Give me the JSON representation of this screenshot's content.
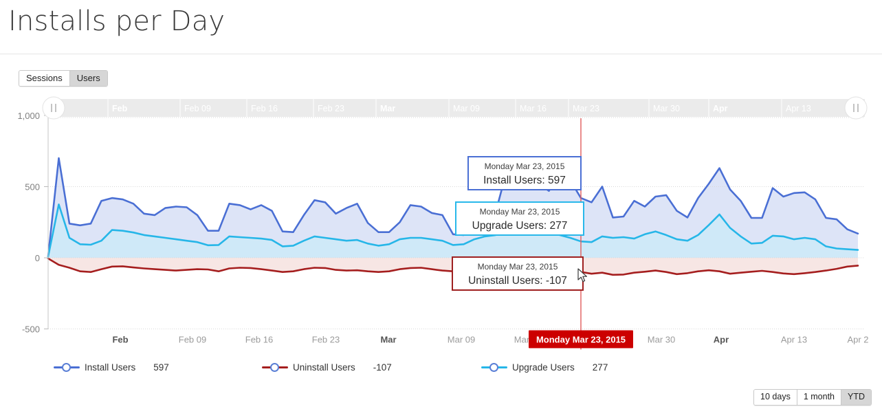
{
  "header": {
    "title": "Installs per Day"
  },
  "mode_toggle": {
    "options": [
      {
        "label": "Sessions",
        "active": false
      },
      {
        "label": "Users",
        "active": true
      }
    ]
  },
  "range_selector": {
    "options": [
      {
        "label": "10 days",
        "active": false
      },
      {
        "label": "1 month",
        "active": false
      },
      {
        "label": "YTD",
        "active": true
      }
    ]
  },
  "navigator": {
    "labels": [
      "Feb",
      "Feb 09",
      "Feb 16",
      "Feb 23",
      "Mar",
      "Mar 09",
      "Mar 16",
      "Mar 23",
      "Mar 30",
      "Apr",
      "Apr 13"
    ],
    "bold": [
      true,
      false,
      false,
      false,
      true,
      false,
      false,
      false,
      false,
      true,
      false
    ],
    "left_handle_icon": "drag-handle-icon",
    "right_handle_icon": "drag-handle-icon"
  },
  "tooltips": [
    {
      "date": "Monday Mar 23, 2015",
      "value": "Install Users: 597",
      "color": "#4a6fd4",
      "name": "install-users"
    },
    {
      "date": "Monday Mar 23, 2015",
      "value": "Upgrade Users: 277",
      "color": "#28b8ea",
      "name": "upgrade-users"
    },
    {
      "date": "Monday Mar 23, 2015",
      "value": "Uninstall Users: -107",
      "color": "#9e2020",
      "name": "uninstall-users"
    }
  ],
  "crosshair": {
    "label": "Monday Mar 23, 2015",
    "color": "#cc0000"
  },
  "legend": [
    {
      "name": "Install Users",
      "value": "597",
      "color": "#4a6fd4"
    },
    {
      "name": "Uninstall Users",
      "value": "-107",
      "color": "#a51e1e"
    },
    {
      "name": "Upgrade Users",
      "value": "277",
      "color": "#26b6e8"
    }
  ],
  "chart_data": {
    "type": "area",
    "title": "Installs per Day",
    "xlabel": "",
    "ylabel": "",
    "ylim": [
      -500,
      1000
    ],
    "yticks": [
      -500,
      0,
      500,
      1000
    ],
    "ytick_labels": [
      "-500",
      "0",
      "500",
      "1,000"
    ],
    "grid": true,
    "legend_position": "bottom",
    "xtick_labels": [
      "Feb",
      "Feb 09",
      "Feb 16",
      "Feb 23",
      "Mar",
      "Mar 09",
      "Mar 16",
      "Mar 23",
      "Mar 30",
      "Apr",
      "Apr 13",
      "Apr 2"
    ],
    "xtick_bold": [
      true,
      false,
      false,
      false,
      true,
      false,
      false,
      false,
      false,
      true,
      false,
      false
    ],
    "xtick_positions": [
      175,
      280,
      377,
      474,
      565,
      671,
      768,
      845,
      962,
      1049,
      1155,
      1248
    ],
    "highlight_index": 51,
    "x_start": "2015-01-26",
    "series": [
      {
        "name": "Install Users",
        "color": "#4a6fd4",
        "fill": "#dde4f7",
        "values": [
          10,
          700,
          240,
          228,
          240,
          400,
          420,
          410,
          380,
          310,
          300,
          350,
          360,
          355,
          300,
          190,
          190,
          380,
          370,
          340,
          370,
          330,
          185,
          180,
          300,
          405,
          390,
          310,
          350,
          380,
          245,
          180,
          180,
          250,
          370,
          360,
          315,
          300,
          165,
          160,
          300,
          320,
          320,
          600,
          650,
          597,
          520,
          470,
          600,
          545,
          420,
          390,
          500,
          283,
          290,
          400,
          360,
          430,
          440,
          330,
          283,
          420,
          520,
          630,
          480,
          400,
          280,
          280,
          490,
          430,
          455,
          460,
          410,
          280,
          270,
          200,
          170
        ]
      },
      {
        "name": "Upgrade Users",
        "color": "#26b6e8",
        "fill": "#cfe9f8",
        "values": [
          8,
          375,
          140,
          95,
          92,
          120,
          195,
          190,
          178,
          160,
          150,
          140,
          130,
          120,
          110,
          88,
          90,
          150,
          145,
          140,
          135,
          125,
          80,
          85,
          120,
          150,
          140,
          130,
          120,
          125,
          100,
          85,
          95,
          130,
          140,
          140,
          130,
          120,
          90,
          95,
          130,
          150,
          160,
          290,
          277,
          277,
          230,
          175,
          160,
          140,
          115,
          110,
          150,
          140,
          145,
          135,
          165,
          185,
          160,
          130,
          120,
          160,
          230,
          305,
          210,
          150,
          100,
          105,
          155,
          150,
          130,
          140,
          130,
          80,
          65,
          60,
          55
        ]
      },
      {
        "name": "Uninstall Users",
        "color": "#a51e1e",
        "fill": "#f7e6e4",
        "values": [
          -5,
          -50,
          -70,
          -95,
          -100,
          -80,
          -62,
          -60,
          -68,
          -75,
          -80,
          -85,
          -90,
          -85,
          -80,
          -82,
          -95,
          -75,
          -70,
          -72,
          -80,
          -90,
          -100,
          -95,
          -80,
          -70,
          -72,
          -85,
          -90,
          -88,
          -95,
          -100,
          -95,
          -80,
          -72,
          -70,
          -80,
          -90,
          -95,
          -100,
          -90,
          -85,
          -80,
          -85,
          -95,
          -107,
          -120,
          -110,
          -95,
          -92,
          -100,
          -112,
          -105,
          -120,
          -118,
          -105,
          -98,
          -90,
          -100,
          -115,
          -108,
          -95,
          -88,
          -95,
          -112,
          -105,
          -98,
          -92,
          -100,
          -110,
          -115,
          -108,
          -100,
          -90,
          -78,
          -62,
          -55
        ]
      }
    ]
  }
}
